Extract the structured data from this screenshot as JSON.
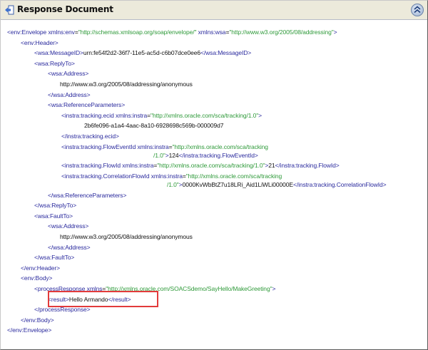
{
  "panel": {
    "title": "Response Document",
    "collapse_icon": "double-chevron-up-icon",
    "title_icon": "document-arrow-icon"
  },
  "colors": {
    "tag": "#2b2b9e",
    "value": "#2f9a3a",
    "text": "#111111",
    "highlight": "#e23b3b",
    "header_bg": "#eceadb"
  },
  "xml_lines": [
    {
      "level": 0,
      "parts": [
        [
          "tag",
          "<env:Envelope "
        ],
        [
          "attr",
          "xmlns:env"
        ],
        [
          "txt",
          "="
        ],
        [
          "val",
          "\"http://schemas.xmlsoap.org/soap/envelope/\""
        ],
        [
          "attr",
          " xmlns:wsa"
        ],
        [
          "txt",
          "="
        ],
        [
          "val",
          "\"http://www.w3.org/2005/08/addressing\""
        ],
        [
          "tag",
          ">"
        ]
      ]
    },
    {
      "level": 1,
      "parts": [
        [
          "tag",
          "<env:Header>"
        ]
      ]
    },
    {
      "level": 2,
      "parts": [
        [
          "tag",
          "<wsa:MessageID>"
        ],
        [
          "txt",
          "urn:fe54f2d2-36f7-11e5-ac5d-c6b07dce0ee6"
        ],
        [
          "tag",
          "</wsa:MessageID>"
        ]
      ]
    },
    {
      "level": 2,
      "parts": [
        [
          "tag",
          "<wsa:ReplyTo>"
        ]
      ]
    },
    {
      "level": 3,
      "parts": [
        [
          "tag",
          "<wsa:Address>"
        ]
      ]
    },
    {
      "level": 4,
      "parts": [
        [
          "txt",
          "http://www.w3.org/2005/08/addressing/anonymous"
        ]
      ]
    },
    {
      "level": 3,
      "parts": [
        [
          "tag",
          "</wsa:Address>"
        ]
      ]
    },
    {
      "level": 3,
      "parts": [
        [
          "tag",
          "<wsa:ReferenceParameters>"
        ]
      ]
    },
    {
      "level": 4,
      "parts": [
        [
          "tag",
          "<instra:tracking.ecid "
        ],
        [
          "attr",
          "xmlns:instra"
        ],
        [
          "txt",
          "="
        ],
        [
          "val",
          "\"http://xmlns.oracle.com/sca/tracking/1.0\""
        ],
        [
          "tag",
          ">"
        ]
      ]
    },
    {
      "level": 5,
      "parts": [
        [
          "txt",
          "2b6fe096-a1a4-4aac-8a10-6928698c569b-000009d7"
        ]
      ]
    },
    {
      "level": 4,
      "parts": [
        [
          "tag",
          "</instra:tracking.ecid>"
        ]
      ]
    },
    {
      "level": 4,
      "parts": [
        [
          "tag",
          "<instra:tracking.FlowEventId "
        ],
        [
          "attr",
          "xmlns:instra"
        ],
        [
          "txt",
          "="
        ],
        [
          "val",
          "\"http://xmlns.oracle.com/sca/tracking"
        ]
      ]
    },
    {
      "level": 4,
      "wrap": "a",
      "parts": [
        [
          "val",
          "/1.0\""
        ],
        [
          "tag",
          ">"
        ],
        [
          "txt",
          "124"
        ],
        [
          "tag",
          "</instra:tracking.FlowEventId>"
        ]
      ]
    },
    {
      "level": 4,
      "parts": [
        [
          "tag",
          "<instra:tracking.FlowId "
        ],
        [
          "attr",
          "xmlns:instra"
        ],
        [
          "txt",
          "="
        ],
        [
          "val",
          "\"http://xmlns.oracle.com/sca/tracking/1.0\""
        ],
        [
          "tag",
          ">"
        ],
        [
          "txt",
          "21"
        ],
        [
          "tag",
          "</instra:tracking.FlowId>"
        ]
      ]
    },
    {
      "level": 4,
      "parts": [
        [
          "tag",
          "<instra:tracking.CorrelationFlowId "
        ],
        [
          "attr",
          "xmlns:instra"
        ],
        [
          "txt",
          "="
        ],
        [
          "val",
          "\"http://xmlns.oracle.com/sca/tracking"
        ]
      ]
    },
    {
      "level": 4,
      "wrap": "b",
      "parts": [
        [
          "val",
          "/1.0\""
        ],
        [
          "tag",
          ">"
        ],
        [
          "txt",
          "0000KvWbBtZ7u18LRi_Aid1LiWLi00000E"
        ],
        [
          "tag",
          "</instra:tracking.CorrelationFlowId>"
        ]
      ]
    },
    {
      "level": 3,
      "parts": [
        [
          "tag",
          "</wsa:ReferenceParameters>"
        ]
      ]
    },
    {
      "level": 2,
      "parts": [
        [
          "tag",
          "</wsa:ReplyTo>"
        ]
      ]
    },
    {
      "level": 2,
      "parts": [
        [
          "tag",
          "<wsa:FaultTo>"
        ]
      ]
    },
    {
      "level": 3,
      "parts": [
        [
          "tag",
          "<wsa:Address>"
        ]
      ]
    },
    {
      "level": 4,
      "parts": [
        [
          "txt",
          "http://www.w3.org/2005/08/addressing/anonymous"
        ]
      ]
    },
    {
      "level": 3,
      "parts": [
        [
          "tag",
          "</wsa:Address>"
        ]
      ]
    },
    {
      "level": 2,
      "parts": [
        [
          "tag",
          "</wsa:FaultTo>"
        ]
      ]
    },
    {
      "level": 1,
      "parts": [
        [
          "tag",
          "</env:Header>"
        ]
      ]
    },
    {
      "level": 1,
      "parts": [
        [
          "tag",
          "<env:Body>"
        ]
      ]
    },
    {
      "level": 2,
      "parts": [
        [
          "tag",
          "<processResponse "
        ],
        [
          "attr",
          "xmlns"
        ],
        [
          "txt",
          "="
        ],
        [
          "val",
          "\"http://xmlns.oracle.com/SOACSdemo/SayHello/MakeGreeting\""
        ],
        [
          "tag",
          ">"
        ]
      ]
    },
    {
      "level": 3,
      "highlight": true,
      "parts": [
        [
          "tag",
          "<result>"
        ],
        [
          "txt",
          "Hello Armando"
        ],
        [
          "tag",
          "</result>"
        ]
      ]
    },
    {
      "level": 2,
      "parts": [
        [
          "tag",
          "</processResponse>"
        ]
      ]
    },
    {
      "level": 1,
      "parts": [
        [
          "tag",
          "</env:Body>"
        ]
      ]
    },
    {
      "level": 0,
      "parts": [
        [
          "tag",
          "</env:Envelope>"
        ]
      ]
    }
  ]
}
